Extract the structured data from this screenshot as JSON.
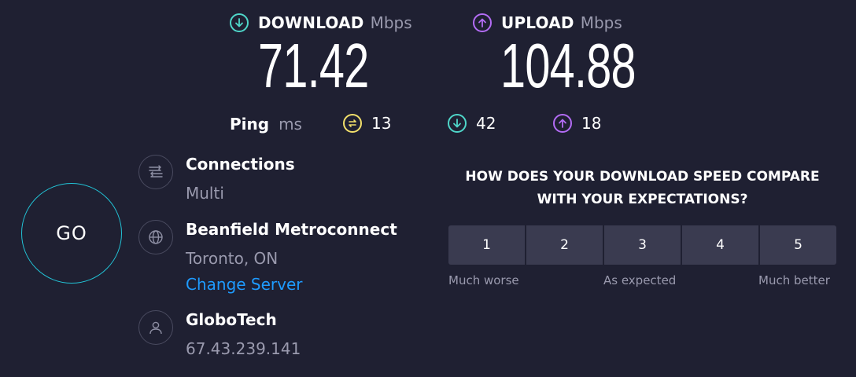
{
  "download": {
    "title": "DOWNLOAD",
    "unit": "Mbps",
    "value": "71.42",
    "icon": "download-arrow-icon",
    "color": "#4fd6c9"
  },
  "upload": {
    "title": "UPLOAD",
    "unit": "Mbps",
    "value": "104.88",
    "icon": "upload-arrow-icon",
    "color": "#b36cf5"
  },
  "ping": {
    "label": "Ping",
    "unit": "ms",
    "idle": {
      "value": "13",
      "icon": "ping-idle-icon",
      "color": "#f3e06b"
    },
    "download": {
      "value": "42",
      "icon": "ping-download-icon",
      "color": "#4fd6c9"
    },
    "upload": {
      "value": "18",
      "icon": "ping-upload-icon",
      "color": "#b36cf5"
    }
  },
  "go_label": "GO",
  "connections": {
    "title": "Connections",
    "value": "Multi",
    "icon": "connections-icon"
  },
  "server": {
    "name": "Beanfield Metroconnect",
    "location": "Toronto, ON",
    "change_label": "Change Server",
    "icon": "globe-icon"
  },
  "provider": {
    "name": "GloboTech",
    "ip": "67.43.239.141",
    "icon": "user-icon"
  },
  "survey": {
    "question_line1": "HOW DOES YOUR DOWNLOAD SPEED COMPARE",
    "question_line2": "WITH YOUR EXPECTATIONS?",
    "options": [
      "1",
      "2",
      "3",
      "4",
      "5"
    ],
    "label_low": "Much worse",
    "label_mid": "As expected",
    "label_high": "Much better"
  }
}
